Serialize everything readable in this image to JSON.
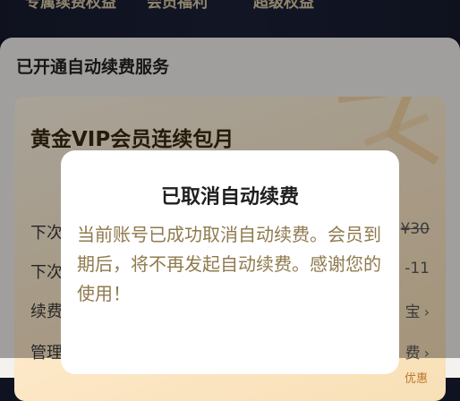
{
  "header": {
    "benefits": [
      "专属续费权益",
      "会员福利",
      "超级权益"
    ]
  },
  "sheet": {
    "title": "已开通自动续费服务",
    "card": {
      "title": "黄金VIP会员连续包月",
      "rows": [
        {
          "label": "下次",
          "value": "¥30"
        },
        {
          "label": "下次",
          "value": "-11"
        },
        {
          "label": "续费",
          "value": "宝"
        },
        {
          "label": "管理",
          "value": "费"
        }
      ],
      "footnote": "优惠"
    }
  },
  "dialog": {
    "title": "已取消自动续费",
    "message": "当前账号已成功取消自动续费。会员到期后，将不再发起自动续费。感谢您的使用！"
  },
  "colors": {
    "card_gold": "#fde9c9",
    "dialog_text": "#8f7a4e"
  }
}
